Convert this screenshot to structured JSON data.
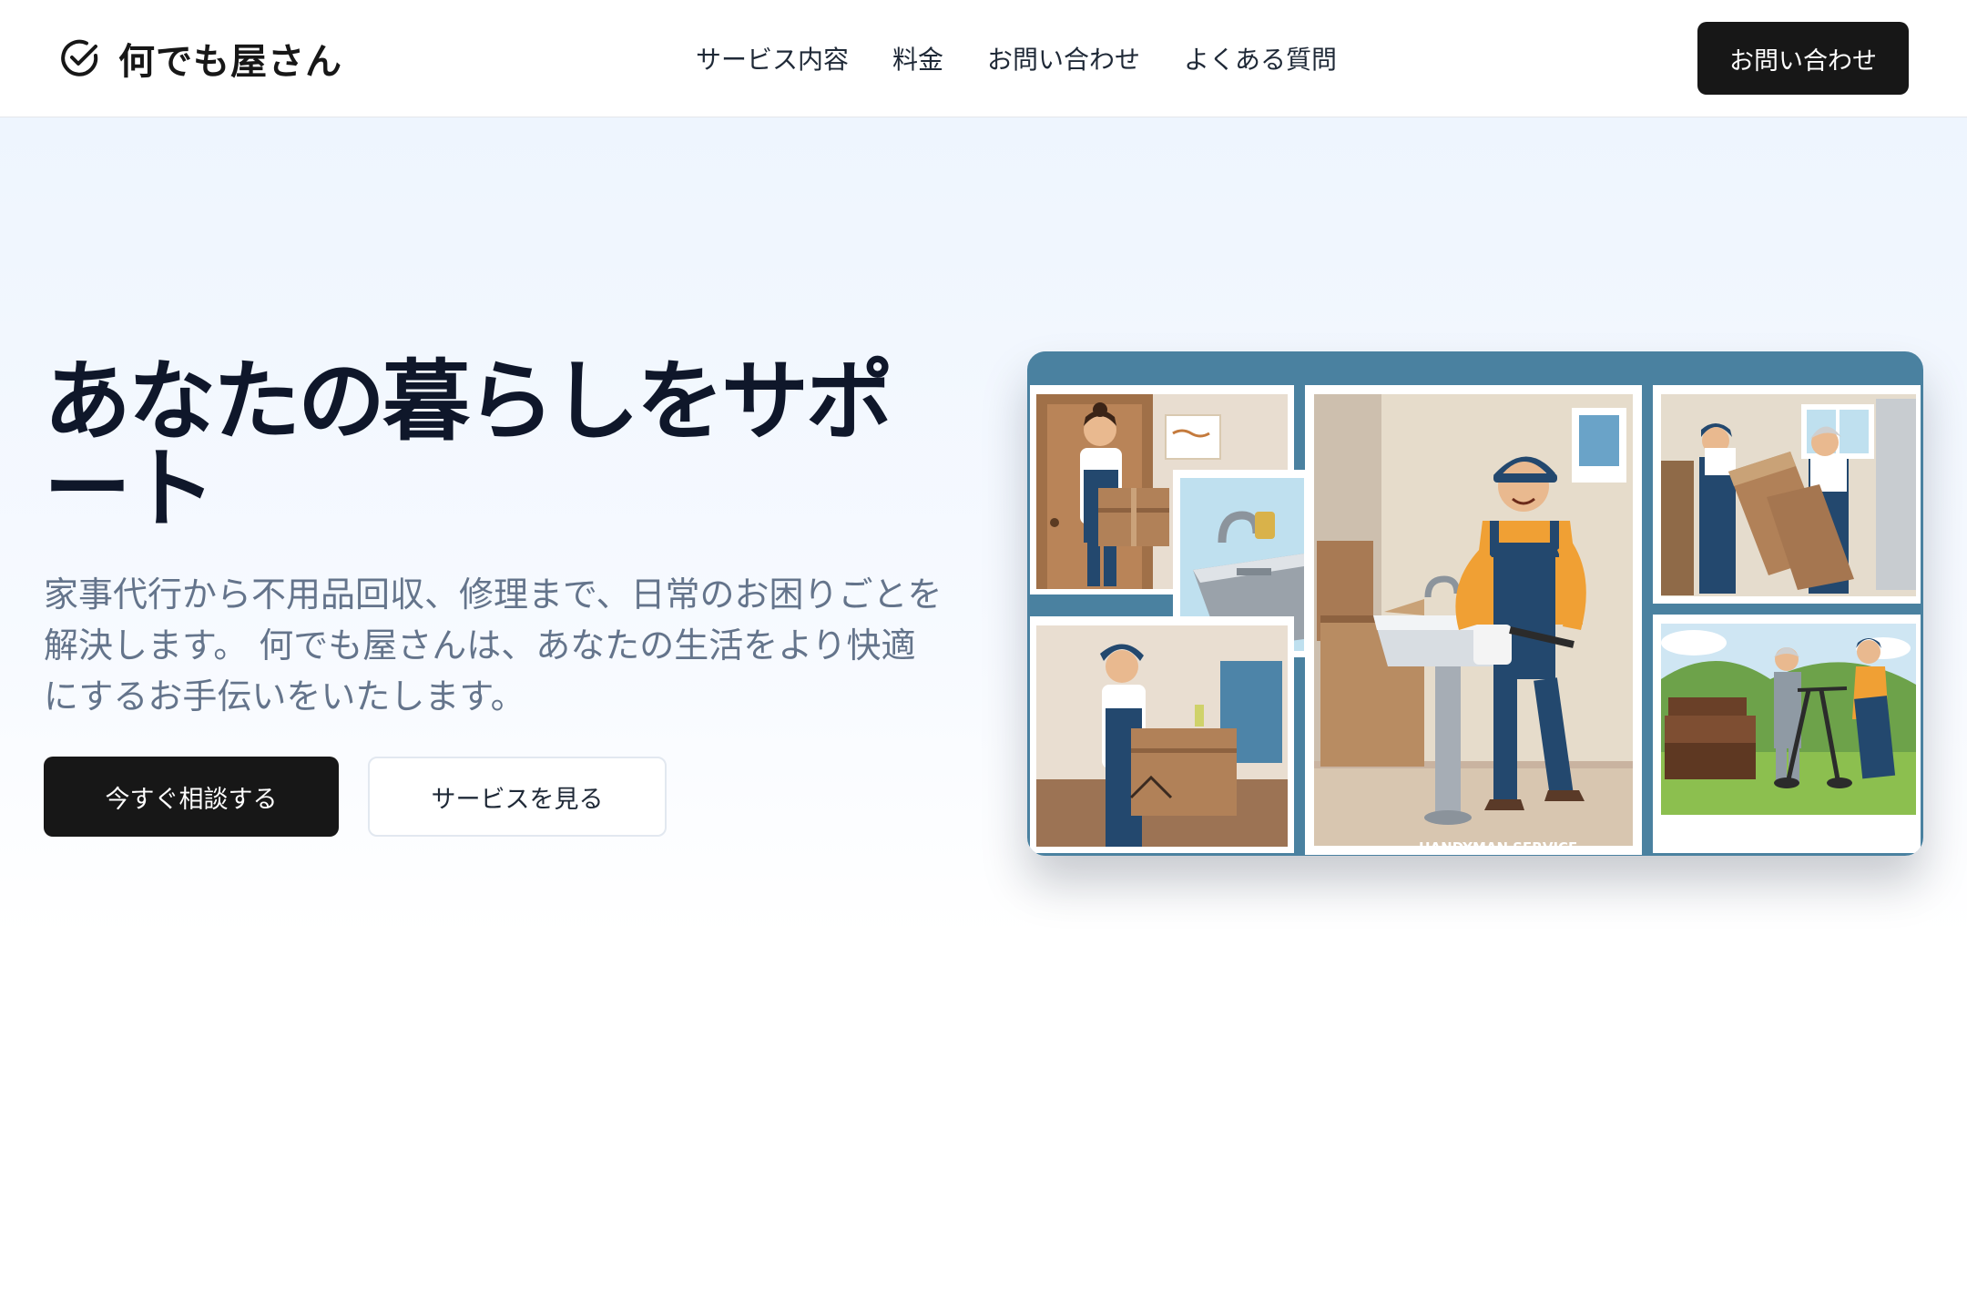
{
  "header": {
    "logo_text": "何でも屋さん",
    "nav": [
      "サービス内容",
      "料金",
      "お問い合わせ",
      "よくある質問"
    ],
    "cta_label": "お問い合わせ"
  },
  "hero": {
    "title": "あなたの暮らしをサポート",
    "description": "家事代行から不用品回収、修理まで、日常のお困りごとを解決します。 何でも屋さんは、あなたの生活をより快適にするお手伝いをいたします。",
    "primary_button": "今すぐ相談する",
    "secondary_button": "サービスを見る",
    "image_caption": "HANDYMAN SERVICE"
  },
  "colors": {
    "dark": "#171717",
    "frame_blue": "#4a81a0",
    "muted_text": "#64748b"
  },
  "icons": {
    "logo": "check-circle-icon"
  }
}
